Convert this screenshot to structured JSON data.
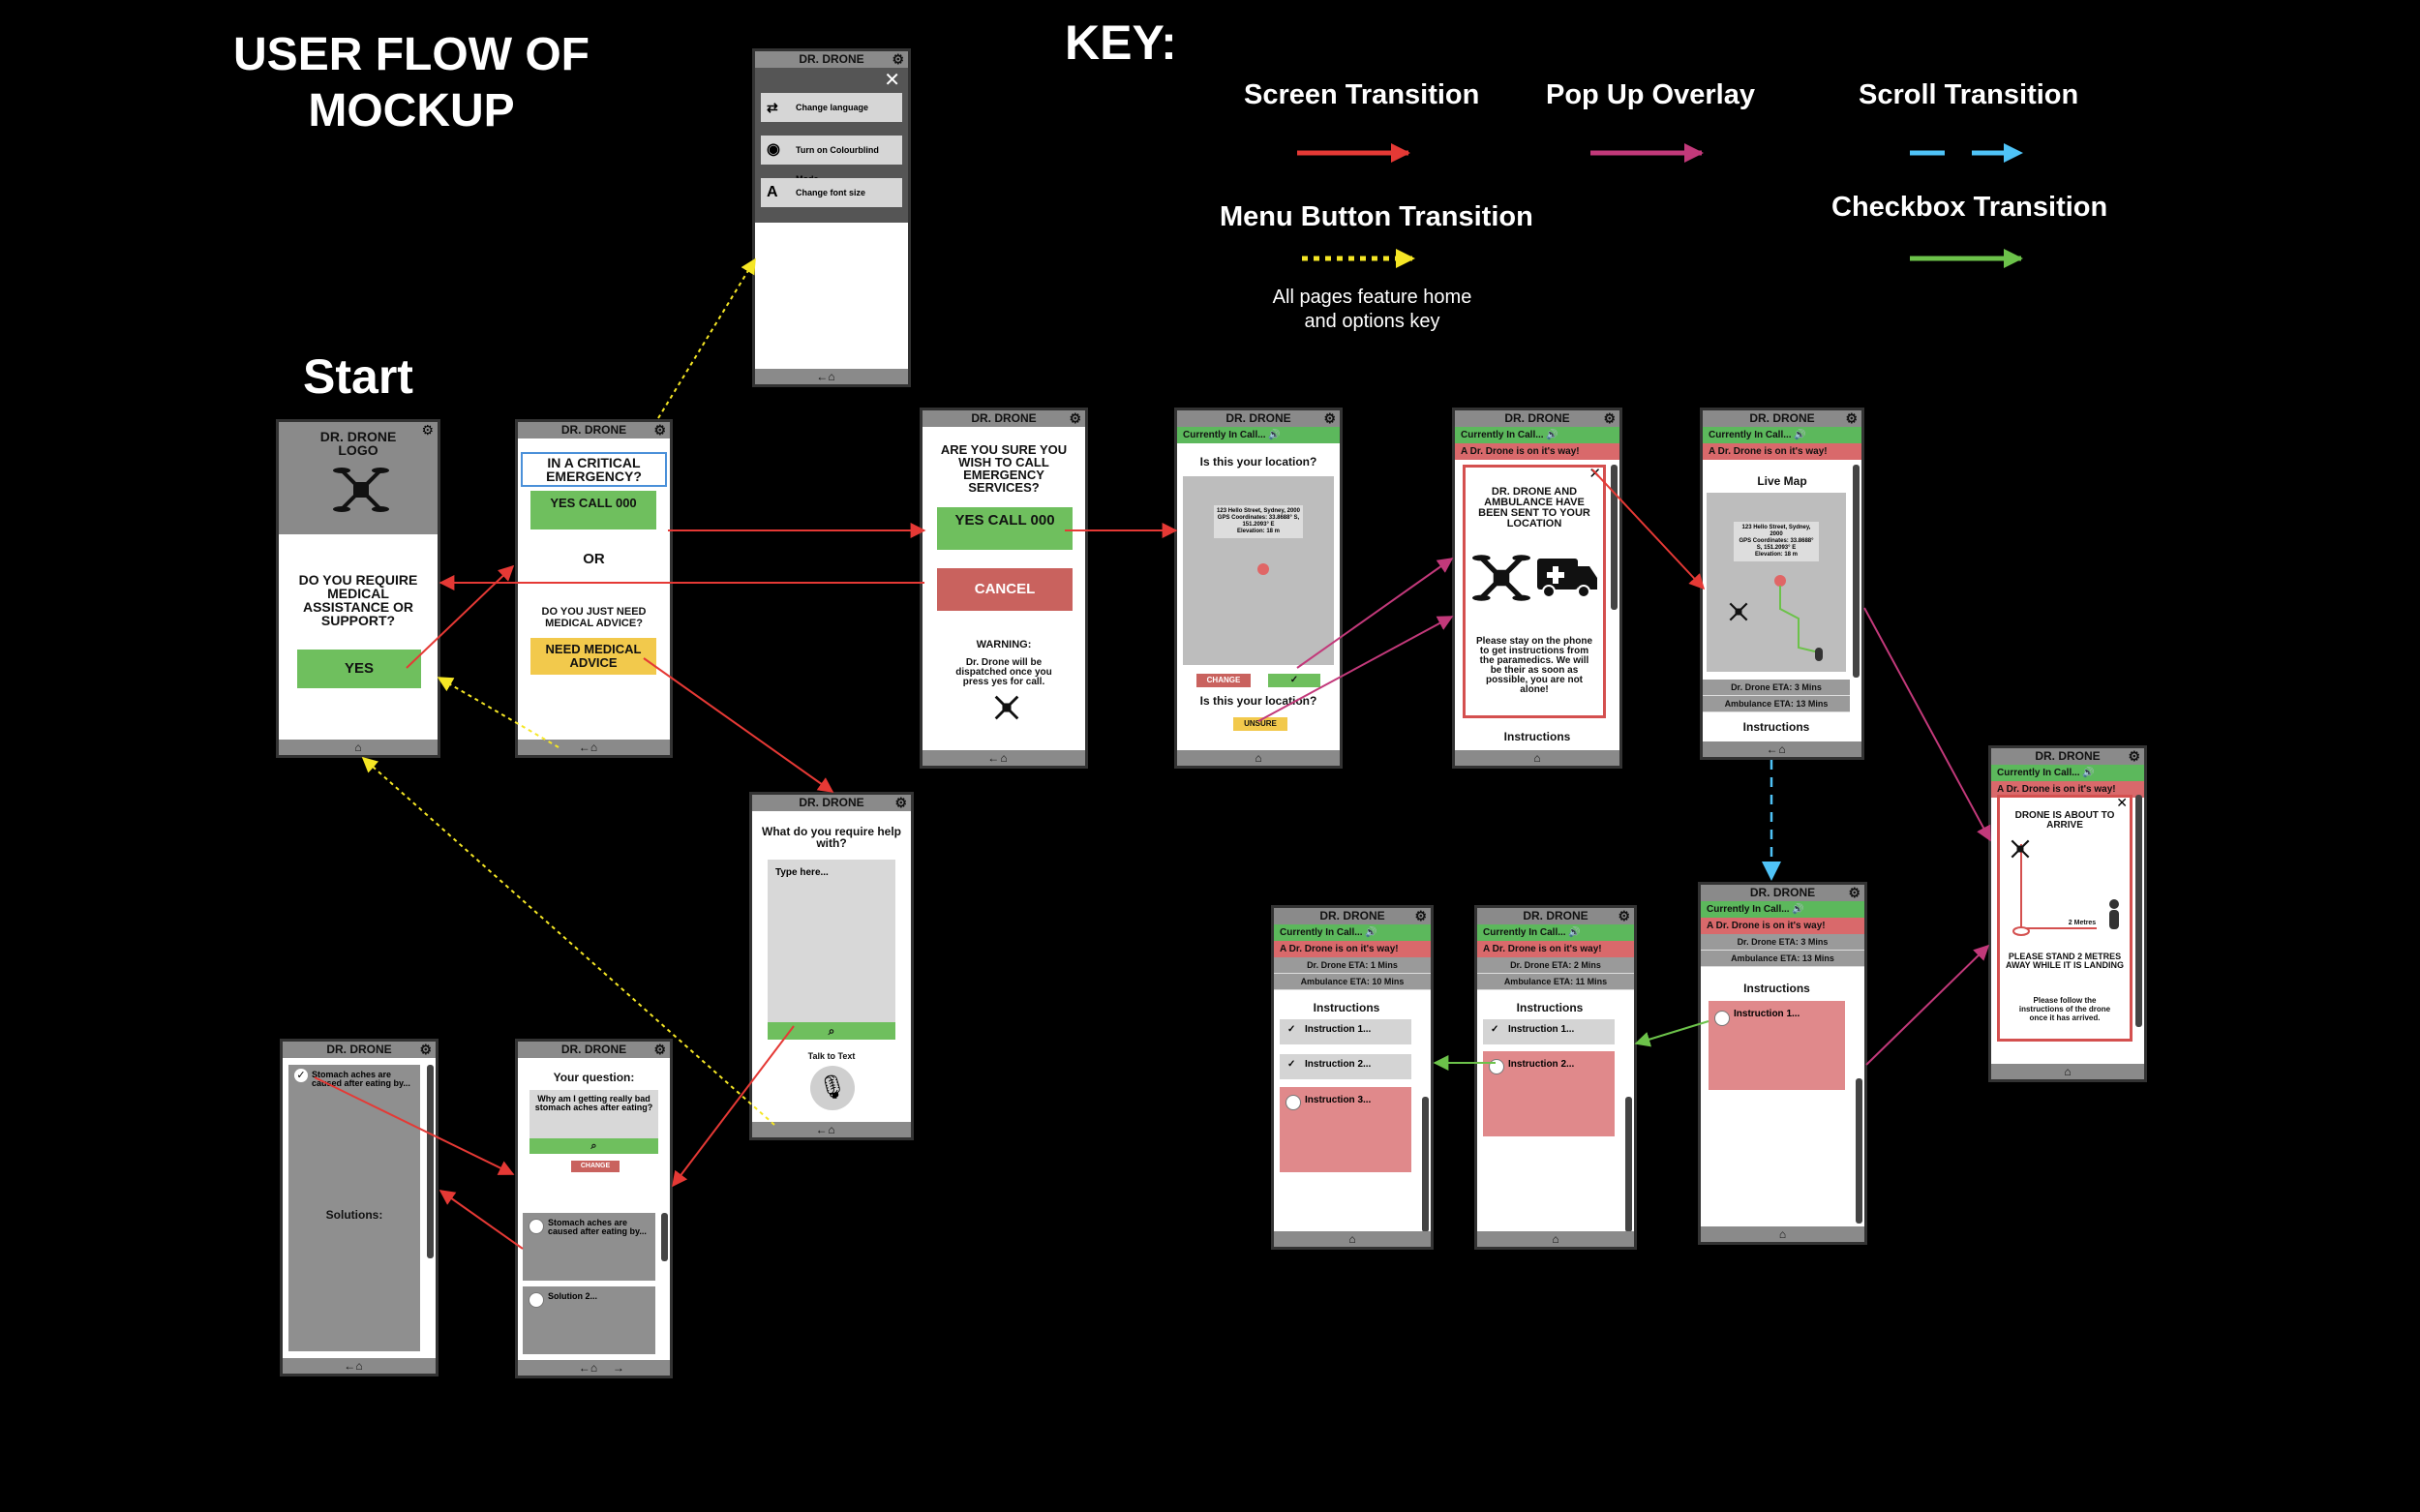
{
  "title": {
    "line1": "USER FLOW OF",
    "line2": "MOCKUP"
  },
  "start_label": "Start",
  "key": {
    "heading": "KEY:",
    "screen_transition": "Screen Transition",
    "popup_overlay": "Pop Up Overlay",
    "scroll_transition": "Scroll Transition",
    "menu_button_transition": "Menu Button Transition",
    "checkbox_transition": "Checkbox Transition",
    "note_line1": "All pages feature home",
    "note_line2": "and options key",
    "colors": {
      "screen": "#e53935",
      "popup": "#c2397a",
      "scroll": "#4fc3f7",
      "menu": "#f5e625",
      "checkbox": "#6cc24a"
    }
  },
  "common": {
    "app_name": "DR. DRONE",
    "in_call": "Currently In Call...",
    "on_way": "A Dr. Drone is on it's way!",
    "instructions": "Instructions",
    "change": "CHANGE",
    "unsure": "UNSURE",
    "is_location": "Is this your location?"
  },
  "screen_start": {
    "logo": "DR. DRONE LOGO",
    "question": "DO YOU REQUIRE MEDICAL ASSISTANCE OR SUPPORT?",
    "yes": "YES"
  },
  "screen_critical": {
    "question": "IN A CRITICAL EMERGENCY?",
    "yes_call": "YES CALL 000",
    "or": "OR",
    "advice_q": "DO YOU JUST NEED MEDICAL ADVICE?",
    "advice_btn": "NEED MEDICAL ADVICE"
  },
  "screen_menu": {
    "item1": "Change language",
    "item2": "Turn on Colourblind Mode",
    "item3": "Change font size"
  },
  "screen_confirm": {
    "question": "ARE YOU SURE YOU WISH TO CALL EMERGENCY SERVICES?",
    "yes_call": "YES CALL 000",
    "cancel": "CANCEL",
    "warning_title": "WARNING:",
    "warning_text": "Dr. Drone will be dispatched once you press yes for call."
  },
  "screen_location": {
    "address": "123 Hello Street, Sydney, 2000",
    "gps": "GPS Coordinates: 33.8688° S, 151.2093° E",
    "elevation": "Elevation: 18 m"
  },
  "screen_sent": {
    "heading": "DR. DRONE AND AMBULANCE HAVE BEEN SENT TO YOUR LOCATION",
    "body": "Please stay on the phone to get instructions from the paramedics. We will be their as soon as possible, you are not alone!"
  },
  "screen_live": {
    "title": "Live Map",
    "drone_eta": "Dr. Drone ETA: 3 Mins",
    "amb_eta": "Ambulance ETA: 13 Mins"
  },
  "screen_arrive": {
    "heading": "DRONE IS ABOUT TO ARRIVE",
    "distance": "2 Metres",
    "stand": "PLEASE STAND 2 METRES AWAY WHILE IT IS LANDING",
    "follow": "Please follow the instructions of the drone once it has arrived."
  },
  "screen_instr1": {
    "drone_eta": "Dr. Drone ETA: 3 Mins",
    "amb_eta": "Ambulance ETA: 13 Mins",
    "item1": "Instruction 1..."
  },
  "screen_instr2": {
    "drone_eta": "Dr. Drone ETA: 2 Mins",
    "amb_eta": "Ambulance ETA: 11 Mins",
    "item1": "Instruction 1...",
    "item2": "Instruction 2..."
  },
  "screen_instr3": {
    "drone_eta": "Dr. Drone ETA: 1 Mins",
    "amb_eta": "Ambulance ETA: 10 Mins",
    "item1": "Instruction 1...",
    "item2": "Instruction 2...",
    "item3": "Instruction 3..."
  },
  "screen_help": {
    "question": "What do you require help with?",
    "placeholder": "Type here...",
    "talk": "Talk to Text"
  },
  "screen_question": {
    "heading": "Your question:",
    "question": "Why am I getting really bad stomach aches after eating?",
    "change": "CHANGE",
    "result1": "Stomach aches are caused after eating by...",
    "result2": "Solution 2..."
  },
  "screen_solution": {
    "result": "Stomach aches are caused after eating by...",
    "solutions": "Solutions:"
  }
}
